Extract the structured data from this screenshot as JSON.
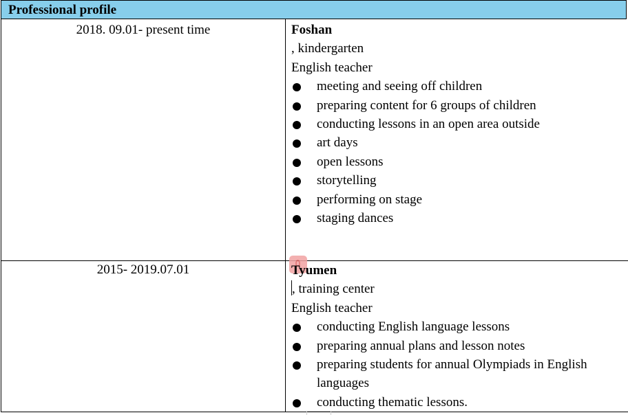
{
  "header": {
    "title": "Professional profile"
  },
  "entries": [
    {
      "date": "2018. 09.01- present time",
      "company": "Foshan",
      "place": ", kindergarten",
      "role": "English teacher",
      "bullets": [
        "meeting and seeing off children",
        "preparing content for 6 groups of children",
        "conducting lessons in an open area outside",
        "art days",
        "open lessons",
        "storytelling",
        "performing on stage",
        "staging dances"
      ]
    },
    {
      "date": "2015- 2019.07.01",
      "company": "Tyumen",
      "place": ", training center",
      "role": "English teacher",
      "bullets": [
        "conducting English language lessons",
        "preparing annual plans and lesson notes",
        "preparing students for annual Olympiads in English languages",
        "conducting thematic lessons."
      ]
    }
  ],
  "colors": {
    "header_bg": "#87ceeb",
    "marker": "#f1a3a3"
  }
}
